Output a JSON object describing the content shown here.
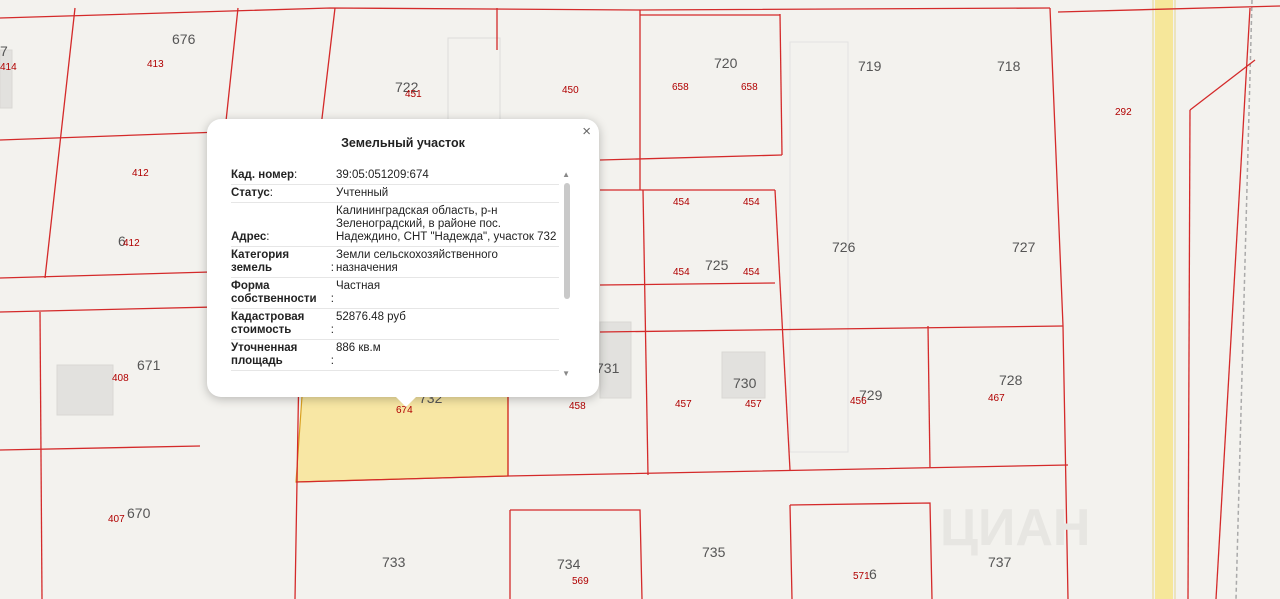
{
  "map": {
    "parcel_numbers": [
      "676",
      "722",
      "720",
      "719",
      "718",
      "726",
      "727",
      "725",
      "730",
      "729",
      "728",
      "671",
      "670",
      "733",
      "734",
      "735",
      "737",
      "731",
      "732"
    ],
    "plot_numbers": [
      "414",
      "413",
      "451",
      "450",
      "658",
      "658",
      "292",
      "412",
      "412",
      "454",
      "454",
      "454",
      "454",
      "408",
      "458",
      "457",
      "457",
      "456",
      "467",
      "674",
      "407",
      "569",
      "571"
    ],
    "partial_labels": [
      "7",
      "6",
      "6"
    ],
    "watermark": "ЦИАН"
  },
  "popup": {
    "title": "Земельный участок",
    "close_symbol": "×",
    "rows": [
      {
        "key": "Кад. номер",
        "value": "39:05:051209:674"
      },
      {
        "key": "Статус",
        "value": "Учтенный"
      },
      {
        "key": "Адрес",
        "value": "Калининградская область, р-н Зеленоградский, в районе пос. Надеждино, СНТ \"Надежда\", участок 732"
      },
      {
        "key": "Категория земель",
        "value": "Земли сельскохозяйственного назначения"
      },
      {
        "key": "Форма собственности",
        "value": "Частная"
      },
      {
        "key": "Кадастровая стоимость",
        "value": "52876.48 руб"
      },
      {
        "key": "Уточненная площадь",
        "value": "886 кв.м"
      }
    ]
  },
  "colors": {
    "boundary": "#d42a2a",
    "selected_fill": "#f8e7a4",
    "road": "#f6e79a",
    "background": "#f3f2ee"
  }
}
